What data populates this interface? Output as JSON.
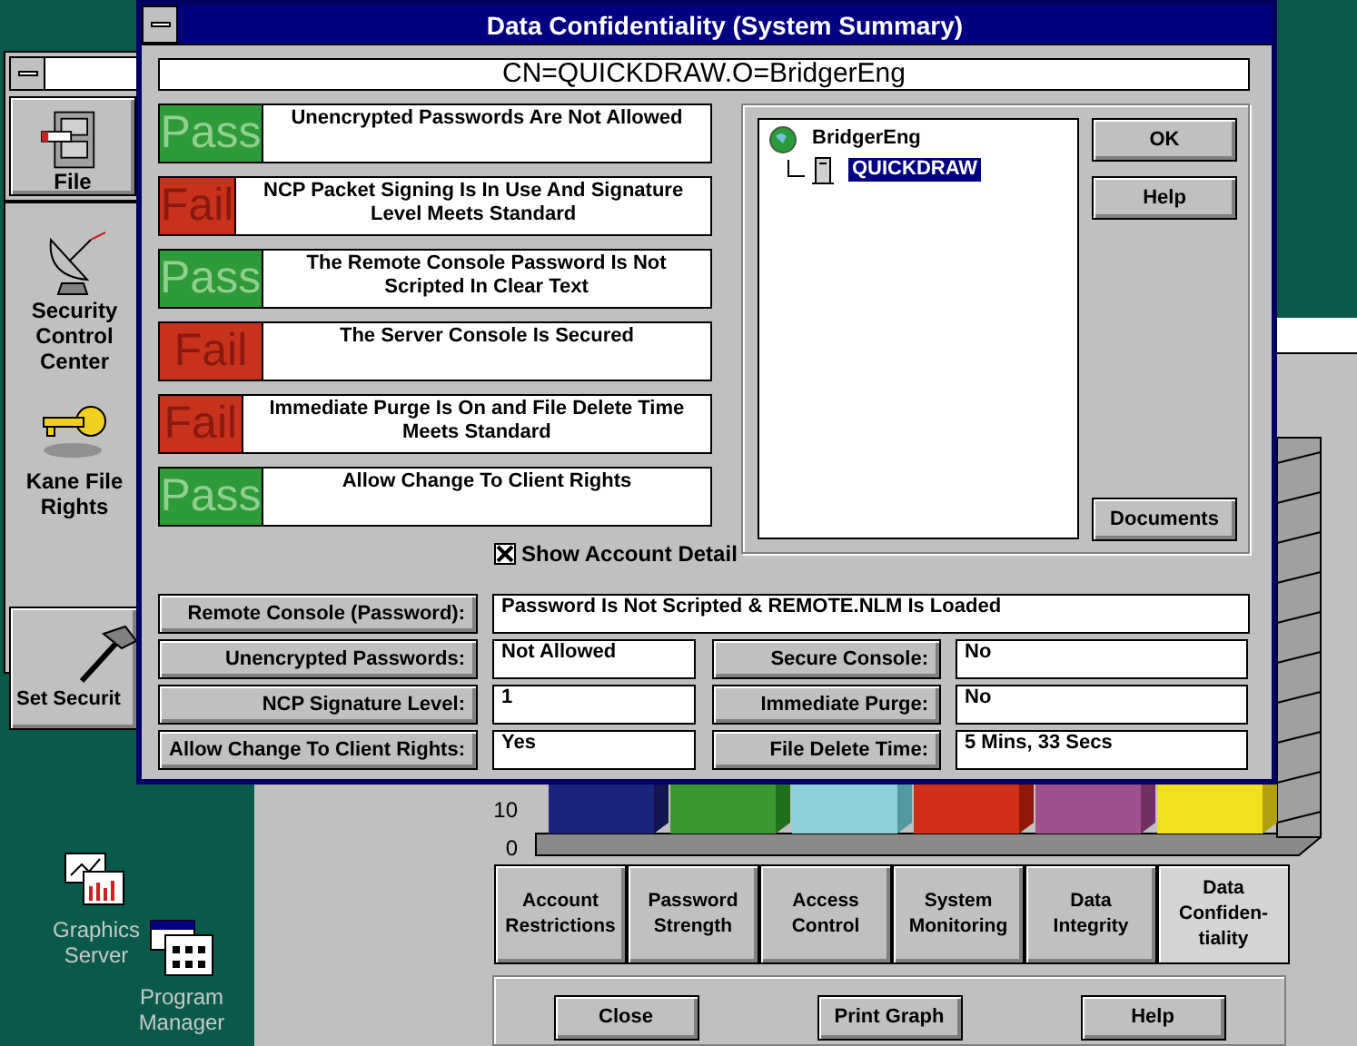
{
  "toolbox_window": {
    "items": [
      {
        "kind": "button",
        "label": "File"
      },
      {
        "kind": "icon",
        "label": "Security Control Center"
      },
      {
        "kind": "icon",
        "label": "Kane File Rights"
      },
      {
        "kind": "button",
        "label": "Set Securit"
      }
    ]
  },
  "graph_window": {
    "chart": {
      "tick_labels": [
        "10",
        "0"
      ]
    },
    "categories": [
      {
        "label": "Account Restrictions",
        "selected": false
      },
      {
        "label": "Password Strength",
        "selected": false
      },
      {
        "label": "Access Control",
        "selected": false
      },
      {
        "label": "System Monitoring",
        "selected": false
      },
      {
        "label": "Data Integrity",
        "selected": false
      },
      {
        "label": "Data Confiden-tiality",
        "selected": true
      }
    ],
    "buttons": [
      "Close",
      "Print Graph",
      "Help"
    ]
  },
  "desktop_icons": [
    {
      "label": "Graphics Server"
    },
    {
      "label": "Program Manager"
    }
  ],
  "dialog": {
    "title": "Data Confidentiality (System Summary)",
    "object_name": "CN=QUICKDRAW.O=BridgerEng",
    "checks": [
      {
        "kind": "pass",
        "result": "Pass",
        "description": "Unencrypted Passwords Are Not Allowed"
      },
      {
        "kind": "fail",
        "result": "Fail",
        "description": "NCP Packet Signing Is In Use And Signature Level Meets Standard"
      },
      {
        "kind": "pass",
        "result": "Pass",
        "description": "The Remote Console Password Is Not Scripted In Clear Text"
      },
      {
        "kind": "fail",
        "result": "Fail",
        "description": "The Server Console Is Secured"
      },
      {
        "kind": "fail",
        "result": "Fail",
        "description": "Immediate Purge Is On and File Delete Time Meets Standard"
      },
      {
        "kind": "pass",
        "result": "Pass",
        "description": "Allow Change To Client Rights"
      }
    ],
    "tree": [
      {
        "label": "BridgerEng",
        "kind": "organization",
        "selected": false,
        "children": [
          {
            "label": "QUICKDRAW",
            "kind": "server",
            "selected": true
          }
        ]
      }
    ],
    "buttons": [
      "OK",
      "Help",
      "Documents"
    ],
    "show_account_detail": {
      "label": "Show Account Detail",
      "checked": true
    },
    "detail_rows": [
      [
        {
          "label": "Remote Console (Password):",
          "value": "Password Is Not Scripted & REMOTE.NLM Is Loaded"
        }
      ],
      [
        {
          "label": "Unencrypted Passwords:",
          "value": "Not Allowed"
        },
        {
          "label": "Secure Console:",
          "value": "No"
        }
      ],
      [
        {
          "label": "NCP Signature Level:",
          "value": "1"
        },
        {
          "label": "Immediate Purge:",
          "value": "No"
        }
      ],
      [
        {
          "label": "Allow Change To Client Rights:",
          "value": "Yes"
        },
        {
          "label": "File Delete Time:",
          "value": "5 Mins, 33 Secs"
        }
      ]
    ]
  }
}
